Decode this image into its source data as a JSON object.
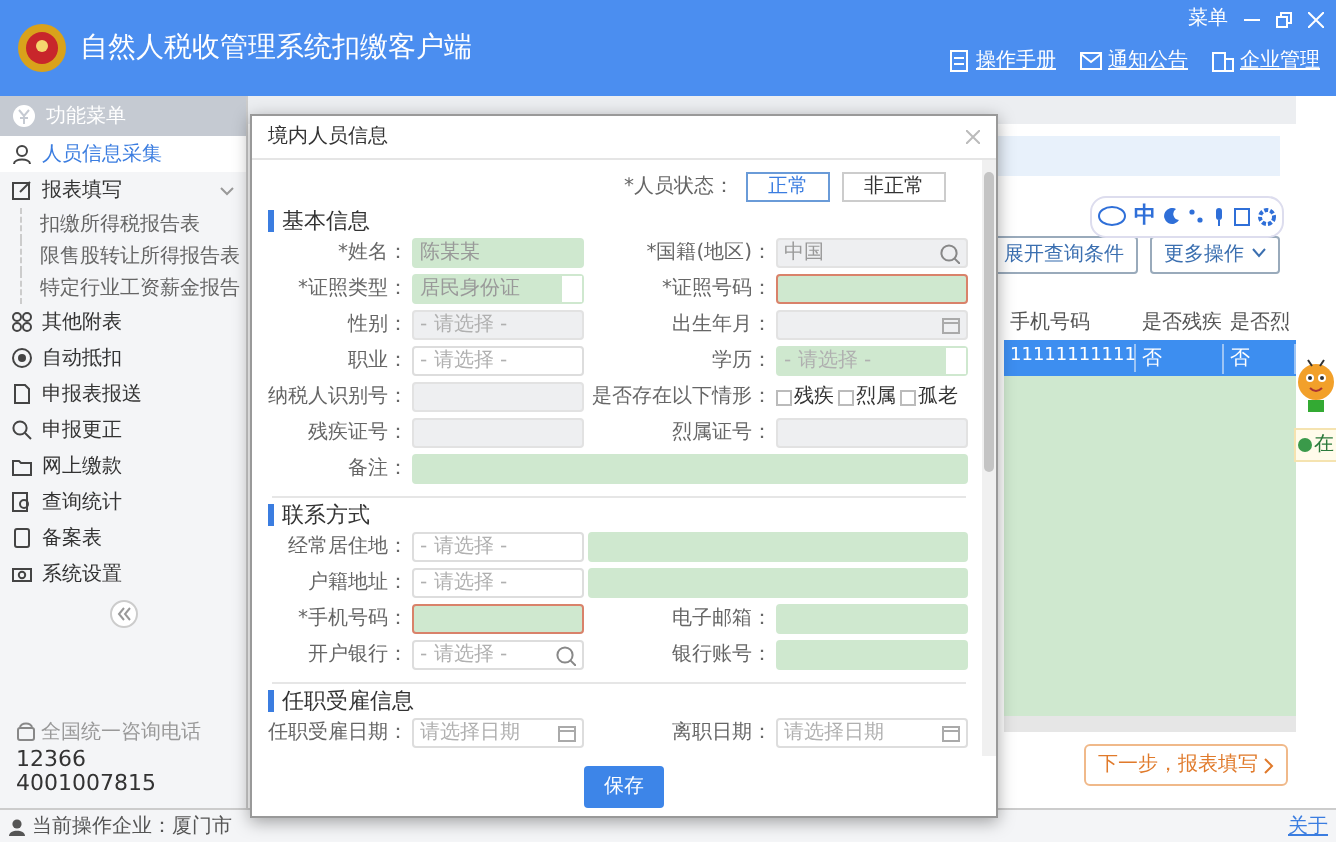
{
  "window": {
    "title": "自然人税收管理系统扣缴客户端",
    "menu": "菜单",
    "links": [
      "操作手册",
      "通知公告",
      "企业管理"
    ]
  },
  "sidebar": {
    "title": "功能菜单",
    "items": [
      {
        "label": "人员信息采集",
        "selected": true
      },
      {
        "label": "报表填写",
        "selected": false,
        "expanded": true,
        "children": [
          {
            "label": "扣缴所得税报告表",
            "selected": false
          },
          {
            "label": "限售股转让所得报告表",
            "selected": false
          },
          {
            "label": "特定行业工资薪金报告",
            "selected": false
          }
        ]
      },
      {
        "label": "其他附表",
        "selected": false
      },
      {
        "label": "自动抵扣",
        "selected": false
      },
      {
        "label": "申报表报送",
        "selected": false
      },
      {
        "label": "申报更正",
        "selected": false
      },
      {
        "label": "网上缴款",
        "selected": false
      },
      {
        "label": "查询统计",
        "selected": false
      },
      {
        "label": "备案表",
        "selected": false
      },
      {
        "label": "系统设置",
        "selected": false
      }
    ],
    "hotline": {
      "label": "全国统一咨询电话",
      "numbers": [
        "12366",
        "4001007815"
      ]
    }
  },
  "main": {
    "ime": {
      "label": "中"
    },
    "buttons": [
      "展开查询条件",
      "更多操作"
    ],
    "table": {
      "columns": [
        "手机号码",
        "是否残疾",
        "是否烈"
      ],
      "rows": [
        {
          "cells": [
            "11111111111",
            "否",
            "否"
          ],
          "selected": true
        }
      ]
    },
    "next_button": "下一步，报表填写",
    "chat_label": "在"
  },
  "dialog": {
    "title": "境内人员信息",
    "status": {
      "label": "*人员状态：",
      "options": [
        {
          "label": "正常",
          "selected": true
        },
        {
          "label": "非正常",
          "selected": false
        }
      ]
    },
    "sections": [
      {
        "title": "基本信息",
        "rows": [
          [
            {
              "label": "*姓名：",
              "kind": "text",
              "value": "陈某某",
              "filled": true
            },
            {
              "label": "*国籍(地区)：",
              "kind": "search",
              "value": "中国",
              "disabled": true
            }
          ],
          [
            {
              "label": "*证照类型：",
              "kind": "select",
              "value": "居民身份证",
              "filled": true
            },
            {
              "label": "*证照号码：",
              "kind": "text",
              "filled": true,
              "invalid": true
            }
          ],
          [
            {
              "label": "性别：",
              "kind": "select",
              "placeholder": "- 请选择 -",
              "disabled": true
            },
            {
              "label": "出生年月：",
              "kind": "date",
              "disabled": true
            }
          ],
          [
            {
              "label": "职业：",
              "kind": "select",
              "placeholder": "- 请选择 -"
            },
            {
              "label": "学历：",
              "kind": "select",
              "placeholder": "- 请选择 -",
              "filled": true
            }
          ],
          [
            {
              "label": "纳税人识别号：",
              "kind": "text",
              "disabled": true
            },
            {
              "label": "是否存在以下情形：",
              "kind": "checks",
              "options": [
                {
                  "label": "残疾",
                  "checked": false
                },
                {
                  "label": "烈属",
                  "checked": false
                },
                {
                  "label": "孤老",
                  "checked": false
                }
              ]
            }
          ],
          [
            {
              "label": "残疾证号：",
              "kind": "text",
              "disabled": true
            },
            {
              "label": "烈属证号：",
              "kind": "text",
              "disabled": true
            }
          ],
          [
            {
              "label": "备注：",
              "kind": "text",
              "filled": true,
              "wide": true
            }
          ]
        ]
      },
      {
        "title": "联系方式",
        "rows": [
          [
            {
              "label": "经常居住地：",
              "kind": "select",
              "placeholder": "- 请选择 -"
            },
            {
              "kind": "text",
              "filled": true,
              "wide": true
            }
          ],
          [
            {
              "label": "户籍地址：",
              "kind": "select",
              "placeholder": "- 请选择 -"
            },
            {
              "kind": "text",
              "filled": true,
              "wide": true
            }
          ],
          [
            {
              "label": "*手机号码：",
              "kind": "text",
              "filled": true,
              "invalid": true
            },
            {
              "label": "电子邮箱：",
              "kind": "text",
              "filled": true
            }
          ],
          [
            {
              "label": "开户银行：",
              "kind": "search",
              "placeholder": "- 请选择 -"
            },
            {
              "label": "银行账号：",
              "kind": "text",
              "filled": true
            }
          ]
        ]
      },
      {
        "title": "任职受雇信息",
        "rows": [
          [
            {
              "label": "任职受雇日期：",
              "kind": "date",
              "placeholder": "请选择日期"
            },
            {
              "label": "离职日期：",
              "kind": "date",
              "placeholder": "请选择日期"
            }
          ]
        ]
      }
    ],
    "save": "保存"
  },
  "status_bar": {
    "company": "当前操作企业：厦门市",
    "about": "关于"
  }
}
